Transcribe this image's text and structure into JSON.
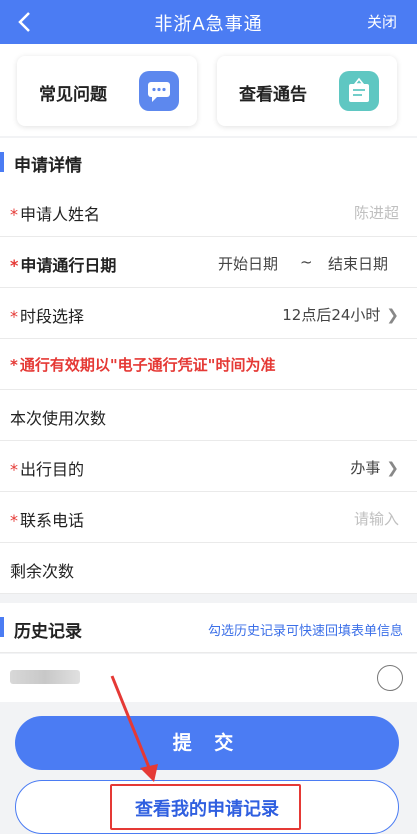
{
  "header": {
    "title": "非浙A急事通",
    "close_label": "关闭"
  },
  "cards": [
    {
      "label": "常见问题",
      "icon": "faq-chat-icon",
      "color": "#5d88ee"
    },
    {
      "label": "查看通告",
      "icon": "notice-board-icon",
      "color": "#5fc7c2"
    }
  ],
  "details": {
    "section_title": "申请详情",
    "rows": [
      {
        "label": "申请人姓名",
        "required": true,
        "value": "陈进超",
        "placeholder": true
      },
      {
        "label": "申请通行日期",
        "required": true,
        "start": "开始日期",
        "sep": "~",
        "end": "结束日期"
      },
      {
        "label": "时段选择",
        "required": true,
        "value": "12点后24小时"
      },
      {
        "label": "通行有效期以\"电子通行凭证\"时间为准",
        "required": true,
        "warning": true
      },
      {
        "label": "本次使用次数",
        "required": false
      },
      {
        "label": "出行目的",
        "required": true,
        "value": "办事"
      },
      {
        "label": "联系电话",
        "required": true,
        "value": "请输入",
        "placeholder": true
      },
      {
        "label": "剩余次数",
        "required": false
      }
    ]
  },
  "history": {
    "title": "历史记录",
    "hint": "勾选历史记录可快速回填表单信息"
  },
  "actions": {
    "submit": "提 交",
    "my_records": "查看我的申请记录"
  },
  "colors": {
    "primary": "#4b7cf3",
    "required": "#e53935",
    "annotation": "#e53935"
  }
}
